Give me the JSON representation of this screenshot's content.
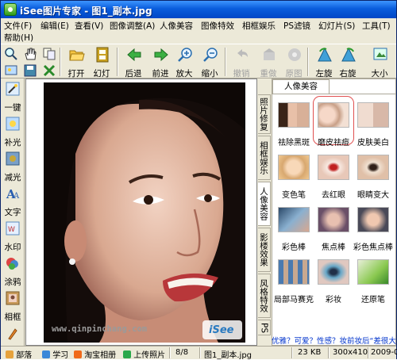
{
  "window": {
    "title": "iSee图片专家 - 图1_副本.jpg"
  },
  "menu": {
    "items": [
      "文件(F)",
      "编辑(E)",
      "查看(V)",
      "图像调整(A)",
      "人像美容",
      "图像特效",
      "相框娱乐",
      "PS滤镜",
      "幻灯片(S)",
      "工具(T)",
      "帮助(H)"
    ]
  },
  "toolbar": {
    "open": "打开",
    "slideshow": "幻灯",
    "back": "后退",
    "forward": "前进",
    "zoom_in": "放大",
    "zoom_out": "缩小",
    "undo": "撤销",
    "redo": "重做",
    "original": "原图",
    "rotate_left": "左旋",
    "rotate_right": "右旋",
    "size": "大小"
  },
  "leftbar": [
    "一键",
    "补光",
    "减光",
    "文字",
    "水印",
    "涂鸦",
    "相框",
    "画笔"
  ],
  "photo": {
    "watermark": "www.qinpinchang.com",
    "logo": "iSee"
  },
  "side_tabs": [
    "照片修复",
    "相框娱乐",
    "人像美容",
    "影楼效果",
    "风格特效",
    "PS"
  ],
  "panel": {
    "tab": "人像美容",
    "effects": [
      "祛除黑斑",
      "磨皮祛痘",
      "皮肤美白",
      "变色笔",
      "去红眼",
      "眼睛变大",
      "彩色棒",
      "焦点棒",
      "彩色焦点棒",
      "局部马赛克",
      "彩妆",
      "还原笔"
    ],
    "selected": "磨皮祛痘"
  },
  "tip": "优雅？可爱？性感？妆前妆后“差很大”",
  "status": {
    "buttons": [
      "部落",
      "学习",
      "淘宝相册",
      "上传照片"
    ],
    "page": "8/8",
    "file": "图1_副本.jpg",
    "filesize": "23 KB",
    "dims": "300x410",
    "date": "2009-05"
  }
}
